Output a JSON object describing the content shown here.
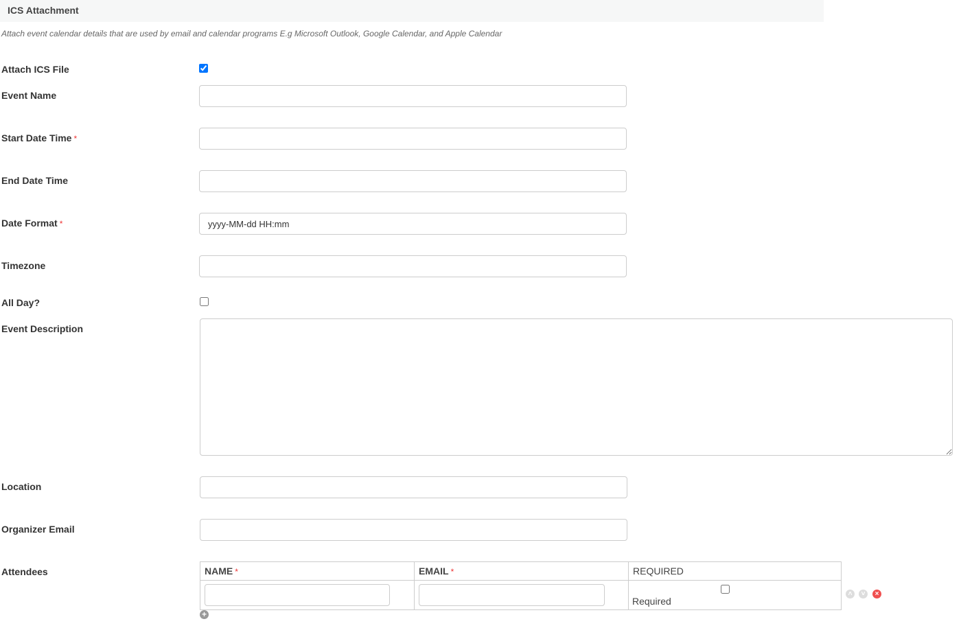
{
  "section": {
    "title": "ICS Attachment",
    "description": "Attach event calendar details that are used by email and calendar programs E.g Microsoft Outlook, Google Calendar, and Apple Calendar"
  },
  "fields": {
    "attach": "Attach ICS File",
    "event_name": "Event Name",
    "start": "Start Date Time",
    "end": "End Date Time",
    "date_format": "Date Format",
    "date_format_value": "yyyy-MM-dd HH:mm",
    "timezone": "Timezone",
    "all_day": "All Day?",
    "description": "Event Description",
    "location": "Location",
    "organizer": "Organizer Email",
    "attendees": "Attendees"
  },
  "required_mark": "*",
  "attendees": {
    "columns": [
      "NAME",
      "EMAIL",
      "REQUIRED"
    ],
    "required_label": "Required"
  }
}
